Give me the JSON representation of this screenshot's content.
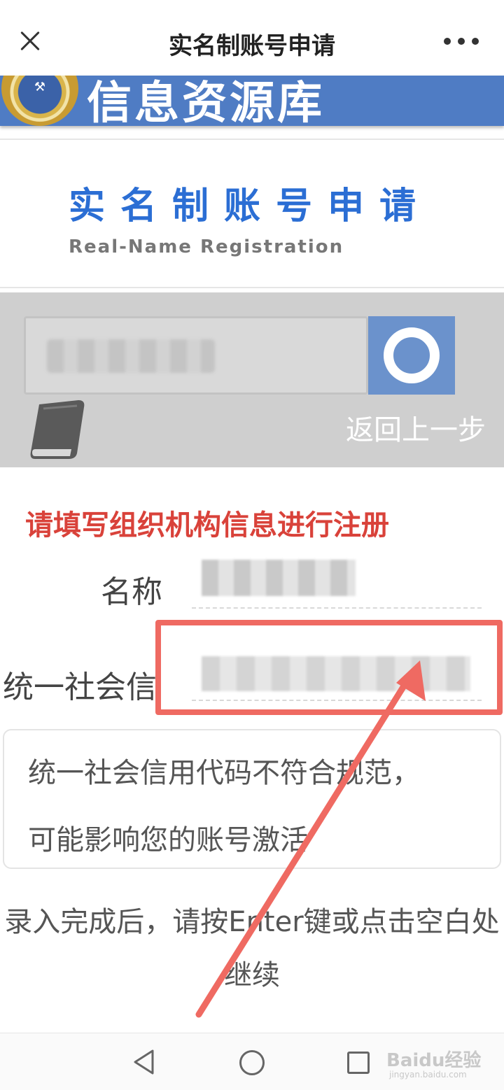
{
  "topbar": {
    "title": "实名制账号申请",
    "close_icon": "close-icon",
    "more_icon": "more-icon"
  },
  "banner": {
    "text": "信息资源库",
    "emblem_icon": "emblem-icon",
    "color": "#4f7cc4"
  },
  "registration": {
    "title": "实名制账号申请",
    "subtitle": "Real-Name Registration",
    "title_color": "#2b6ed4"
  },
  "search": {
    "button_icon": "search-icon",
    "guide_icon": "book-icon",
    "back_label": "返回上一步"
  },
  "form": {
    "heading": "请填写组织机构信息进行注册",
    "heading_color": "#d9423a",
    "name_label": "名称",
    "code_label": "统一社会信",
    "notice_line1": "统一社会信用代码不符合规范，",
    "notice_line2": "可能影响您的账号激活",
    "hint": "录入完成后，请按Enter键或点击空白处继续"
  },
  "annotation": {
    "highlight_color": "#ef6a62"
  },
  "navbar": {
    "back_icon": "nav-back-icon",
    "home_icon": "nav-home-icon",
    "recent_icon": "nav-recent-icon",
    "watermark": "Baidu经验",
    "watermark_sub": "jingyan.baidu.com"
  }
}
